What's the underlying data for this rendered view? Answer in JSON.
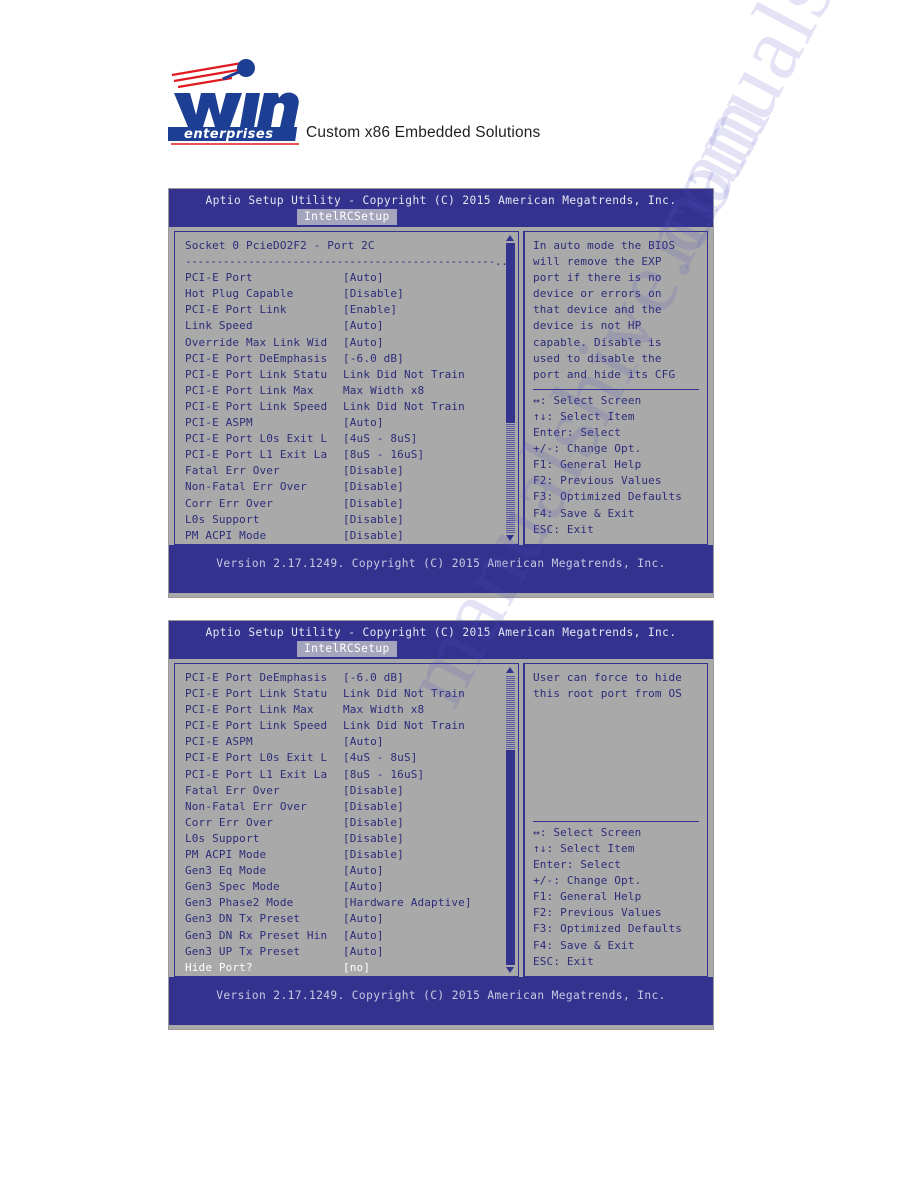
{
  "letterhead": {
    "logo_word": "win",
    "logo_sub": "enterprises",
    "tagline": "Custom x86 Embedded Solutions",
    "colors": {
      "logo_blue": "#1c3f94",
      "logo_red": "#e01b22",
      "text": "#231f20"
    }
  },
  "watermark": {
    "text": "manualshive.com"
  },
  "bios_common": {
    "title": "Aptio Setup Utility - Copyright (C) 2015 American Megatrends, Inc.",
    "tab": "IntelRCSetup",
    "footer": "Version 2.17.1249. Copyright (C) 2015 American Megatrends, Inc.",
    "separator": "-------------------------------------------------...",
    "keys": [
      "↔: Select Screen",
      "↑↓: Select Item",
      "Enter: Select",
      "+/-: Change Opt.",
      "F1: General Help",
      "F2: Previous Values",
      "F3: Optimized Defaults",
      "F4: Save & Exit",
      "ESC: Exit"
    ],
    "colors": {
      "header_blue": "#33338f",
      "body_gray": "#a9a9a9",
      "text_blue": "#2c2c7a",
      "selected_text": "#ffffff"
    }
  },
  "screen1": {
    "heading": "Socket 0 PcieDO2F2 - Port 2C",
    "rows": [
      {
        "label": "PCI-E Port",
        "value": "[Auto]"
      },
      {
        "label": "Hot Plug Capable",
        "value": "[Disable]"
      },
      {
        "label": "PCI-E Port Link",
        "value": "[Enable]"
      },
      {
        "label": "Link Speed",
        "value": "[Auto]"
      },
      {
        "label": "Override Max Link Wid",
        "value": "[Auto]"
      },
      {
        "label": "PCI-E Port DeEmphasis",
        "value": "[-6.0 dB]"
      },
      {
        "label": "PCI-E Port Link Statu",
        "value": "Link Did Not Train"
      },
      {
        "label": "PCI-E Port Link Max",
        "value": "Max Width x8"
      },
      {
        "label": "PCI-E Port Link Speed",
        "value": "Link Did Not Train"
      },
      {
        "label": "PCI-E ASPM",
        "value": "[Auto]"
      },
      {
        "label": "PCI-E Port L0s Exit L",
        "value": "[4uS - 8uS]"
      },
      {
        "label": "PCI-E Port L1 Exit La",
        "value": "[8uS - 16uS]"
      },
      {
        "label": "Fatal Err Over",
        "value": "[Disable]"
      },
      {
        "label": "Non-Fatal Err Over",
        "value": "[Disable]"
      },
      {
        "label": "Corr Err Over",
        "value": "[Disable]"
      },
      {
        "label": "L0s Support",
        "value": "[Disable]"
      },
      {
        "label": "PM ACPI Mode",
        "value": "[Disable]"
      }
    ],
    "help": [
      "In auto mode the BIOS",
      "will remove the EXP",
      "port if there is no",
      "device or errors on",
      "that device and the",
      "device is not HP",
      "capable. Disable is",
      "used to disable the",
      "port and hide its CFG"
    ],
    "scroll": {
      "thumb_top_pct": 0,
      "thumb_height_pct": 62
    }
  },
  "screen2": {
    "rows": [
      {
        "label": "PCI-E Port DeEmphasis",
        "value": "[-6.0 dB]"
      },
      {
        "label": "PCI-E Port Link Statu",
        "value": "Link Did Not Train"
      },
      {
        "label": "PCI-E Port Link Max",
        "value": "Max Width x8"
      },
      {
        "label": "PCI-E Port Link Speed",
        "value": "Link Did Not Train"
      },
      {
        "label": "PCI-E ASPM",
        "value": "[Auto]"
      },
      {
        "label": "PCI-E Port L0s Exit L",
        "value": "[4uS - 8uS]"
      },
      {
        "label": "PCI-E Port L1 Exit La",
        "value": "[8uS - 16uS]"
      },
      {
        "label": "Fatal Err Over",
        "value": "[Disable]"
      },
      {
        "label": "Non-Fatal Err Over",
        "value": "[Disable]"
      },
      {
        "label": "Corr Err Over",
        "value": "[Disable]"
      },
      {
        "label": "L0s Support",
        "value": "[Disable]"
      },
      {
        "label": "PM ACPI Mode",
        "value": "[Disable]"
      },
      {
        "label": "Gen3 Eq Mode",
        "value": "[Auto]"
      },
      {
        "label": "Gen3 Spec Mode",
        "value": "[Auto]"
      },
      {
        "label": "Gen3 Phase2 Mode",
        "value": "[Hardware Adaptive]"
      },
      {
        "label": "Gen3 DN Tx Preset",
        "value": "[Auto]"
      },
      {
        "label": "Gen3 DN Rx Preset Hin",
        "value": "[Auto]"
      },
      {
        "label": "Gen3 UP Tx Preset",
        "value": "[Auto]"
      },
      {
        "label": "Hide Port?",
        "value": "[no]",
        "selected": true
      }
    ],
    "help": [
      "User can force to hide",
      "this root port from OS"
    ],
    "scroll": {
      "thumb_top_pct": 26,
      "thumb_height_pct": 74
    }
  }
}
